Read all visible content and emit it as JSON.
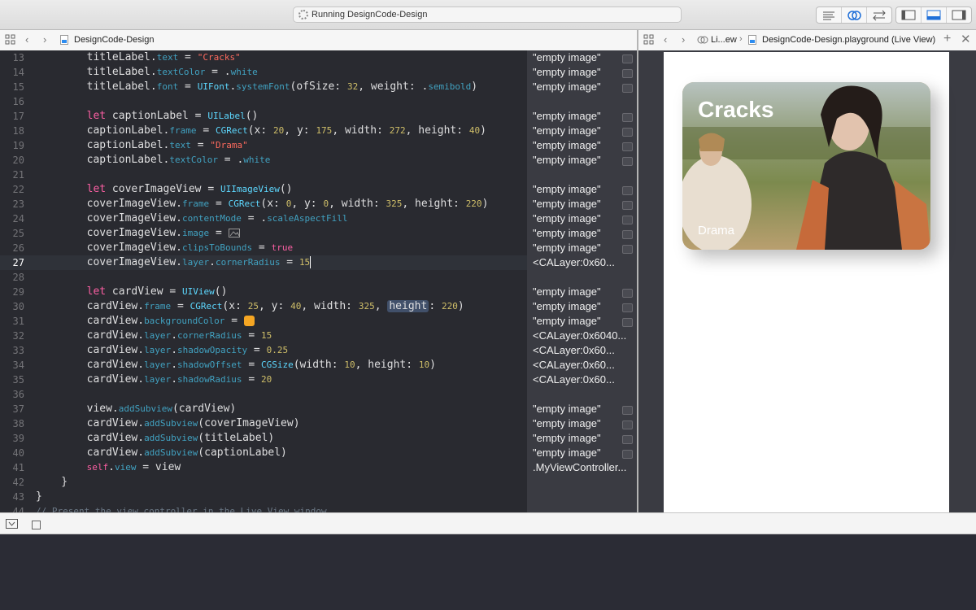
{
  "toolbar": {
    "activity_text": "Running DesignCode-Design"
  },
  "jumpbar": {
    "file_name": "DesignCode-Design"
  },
  "liveview_jumpbar": {
    "crumb_short": "Li...ew",
    "crumb_file": "DesignCode-Design.playground (Live View)"
  },
  "code_lines": [
    {
      "n": "13",
      "text": "        titleLabel.text = \"Cracks\""
    },
    {
      "n": "14",
      "text": "        titleLabel.textColor = .white"
    },
    {
      "n": "15",
      "text": "        titleLabel.font = UIFont.systemFont(ofSize: 32, weight: .semibold)"
    },
    {
      "n": "16",
      "text": ""
    },
    {
      "n": "17",
      "text": "        let captionLabel = UILabel()"
    },
    {
      "n": "18",
      "text": "        captionLabel.frame = CGRect(x: 20, y: 175, width: 272, height: 40)"
    },
    {
      "n": "19",
      "text": "        captionLabel.text = \"Drama\""
    },
    {
      "n": "20",
      "text": "        captionLabel.textColor = .white"
    },
    {
      "n": "21",
      "text": ""
    },
    {
      "n": "22",
      "text": "        let coverImageView = UIImageView()"
    },
    {
      "n": "23",
      "text": "        coverImageView.frame = CGRect(x: 0, y: 0, width: 325, height: 220)"
    },
    {
      "n": "24",
      "text": "        coverImageView.contentMode = .scaleAspectFill"
    },
    {
      "n": "25",
      "text": "        coverImageView.image = "
    },
    {
      "n": "26",
      "text": "        coverImageView.clipsToBounds = true"
    },
    {
      "n": "27",
      "text": "        coverImageView.layer.cornerRadius = 15"
    },
    {
      "n": "28",
      "text": ""
    },
    {
      "n": "29",
      "text": "        let cardView = UIView()"
    },
    {
      "n": "30",
      "text": "        cardView.frame = CGRect(x: 25, y: 40, width: 325, height: 220)"
    },
    {
      "n": "31",
      "text": "        cardView.backgroundColor = "
    },
    {
      "n": "32",
      "text": "        cardView.layer.cornerRadius = 15"
    },
    {
      "n": "33",
      "text": "        cardView.layer.shadowOpacity = 0.25"
    },
    {
      "n": "34",
      "text": "        cardView.layer.shadowOffset = CGSize(width: 10, height: 10)"
    },
    {
      "n": "35",
      "text": "        cardView.layer.shadowRadius = 20"
    },
    {
      "n": "36",
      "text": ""
    },
    {
      "n": "37",
      "text": "        view.addSubview(cardView)"
    },
    {
      "n": "38",
      "text": "        cardView.addSubview(coverImageView)"
    },
    {
      "n": "39",
      "text": "        cardView.addSubview(titleLabel)"
    },
    {
      "n": "40",
      "text": "        cardView.addSubview(captionLabel)"
    },
    {
      "n": "41",
      "text": "        self.view = view"
    },
    {
      "n": "42",
      "text": "    }"
    },
    {
      "n": "43",
      "text": "}"
    },
    {
      "n": "44",
      "text": "// Present the view controller in the Live View window"
    }
  ],
  "results": [
    "\"empty image\"",
    "\"empty image\"",
    "\"empty image\"",
    "",
    "\"empty image\"",
    "\"empty image\"",
    "\"empty image\"",
    "\"empty image\"",
    "",
    "\"empty image\"",
    "\"empty image\"",
    "\"empty image\"",
    "\"empty image\"",
    "\"empty image\"",
    "<CALayer:0x60...",
    "",
    "\"empty image\"",
    "\"empty image\"",
    "\"empty image\"",
    "<CALayer:0x6040...",
    "<CALayer:0x60...",
    "<CALayer:0x60...",
    "<CALayer:0x60...",
    "",
    "\"empty image\"",
    "\"empty image\"",
    "\"empty image\"",
    "\"empty image\"",
    ".MyViewController...",
    "",
    "",
    ""
  ],
  "card": {
    "title": "Cracks",
    "caption": "Drama",
    "background_color": "#f5a623"
  },
  "colors": {
    "editor_bg": "#292a30",
    "keyword": "#fc5fa3",
    "string": "#fc6a5d",
    "number": "#d0bf69",
    "property": "#41a1c0"
  }
}
